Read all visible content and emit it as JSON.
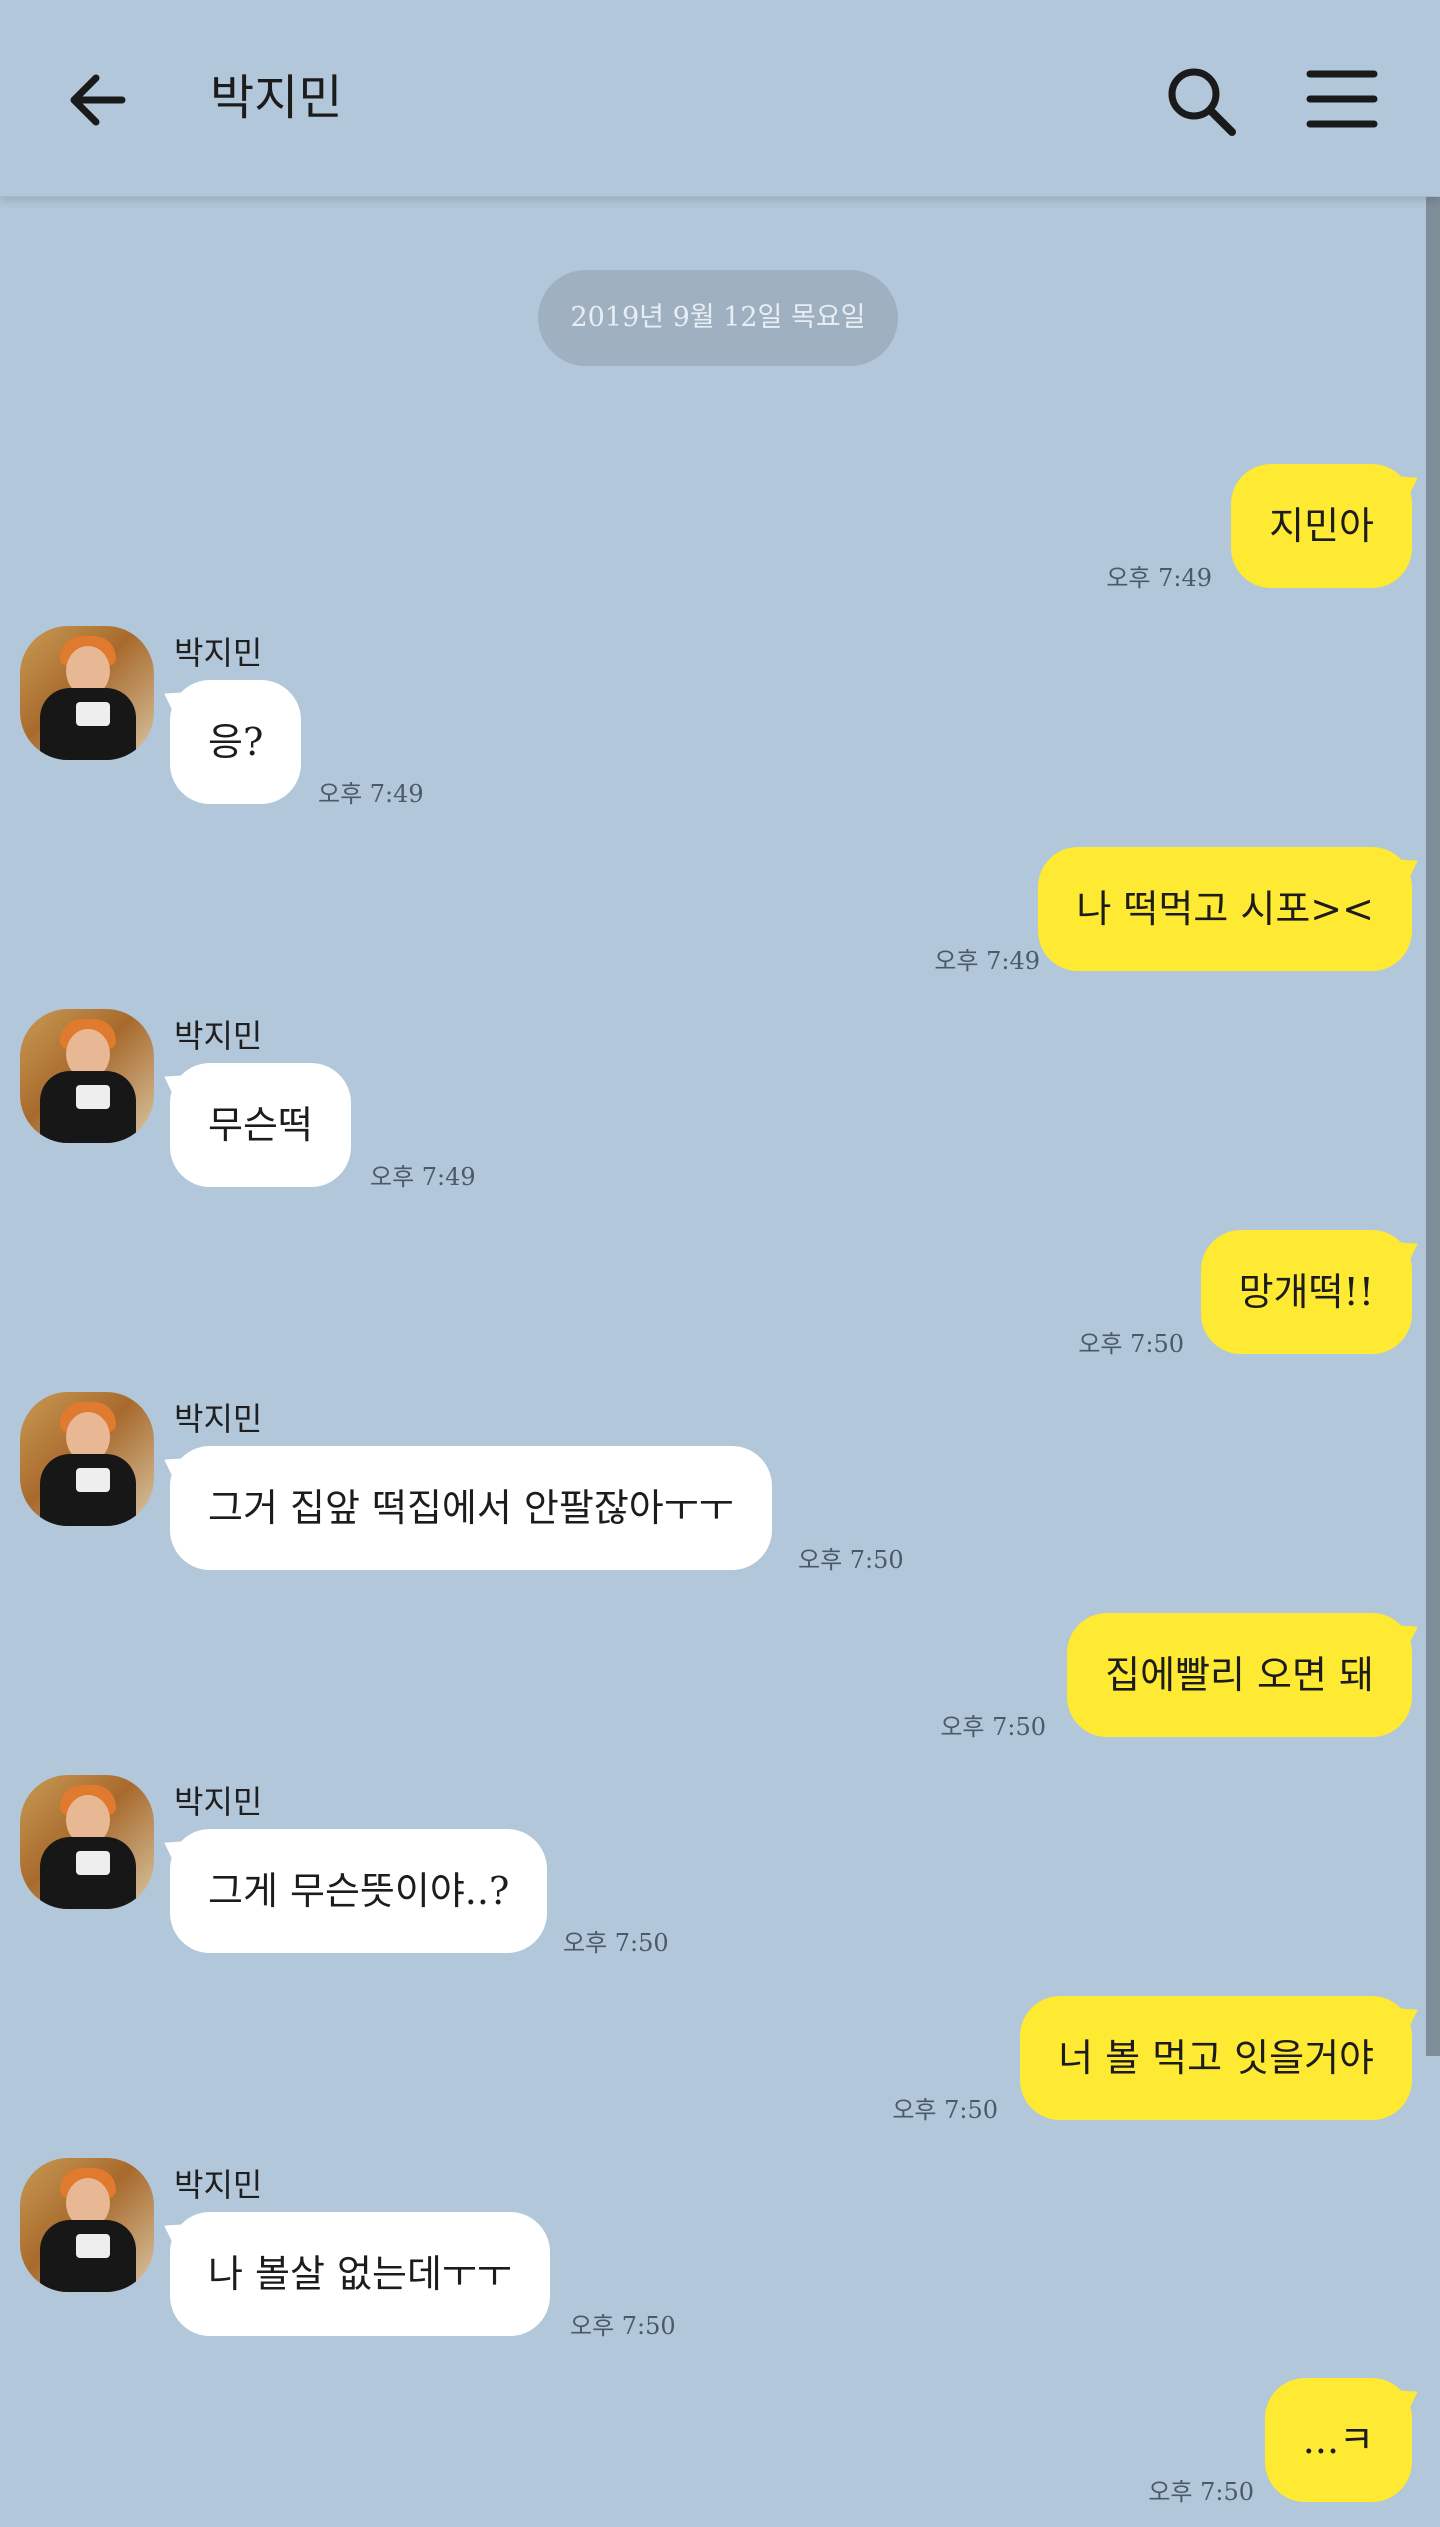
{
  "header": {
    "title": "박지민",
    "back_icon": "arrow-left-icon",
    "search_icon": "search-icon",
    "menu_icon": "hamburger-menu-icon"
  },
  "date_divider": "2019년 9월 12일 목요일",
  "colors": {
    "background": "#b2c7da",
    "my_bubble": "#fee933",
    "their_bubble": "#ffffff"
  },
  "messages": [
    {
      "from": "me",
      "text": "지민아",
      "time": "오후 7:49"
    },
    {
      "from": "them",
      "sender": "박지민",
      "text": "응?",
      "time": "오후 7:49"
    },
    {
      "from": "me",
      "text": "나 떡먹고 시포><",
      "time": "오후 7:49"
    },
    {
      "from": "them",
      "sender": "박지민",
      "text": "무슨떡",
      "time": "오후 7:49"
    },
    {
      "from": "me",
      "text": "망개떡!!",
      "time": "오후 7:50"
    },
    {
      "from": "them",
      "sender": "박지민",
      "text": "그거 집앞 떡집에서 안팔잖아ㅜㅜ",
      "time": "오후 7:50"
    },
    {
      "from": "me",
      "text": "집에빨리 오면 돼",
      "time": "오후 7:50"
    },
    {
      "from": "them",
      "sender": "박지민",
      "text": "그게 무슨뜻이야..?",
      "time": "오후 7:50"
    },
    {
      "from": "me",
      "text": "너 볼 먹고 잇을거야",
      "time": "오후 7:50"
    },
    {
      "from": "them",
      "sender": "박지민",
      "text": "나 볼살 없는데ㅜㅜ",
      "time": "오후 7:50"
    },
    {
      "from": "me",
      "text": "...ㅋ",
      "time": "오후 7:50"
    }
  ]
}
